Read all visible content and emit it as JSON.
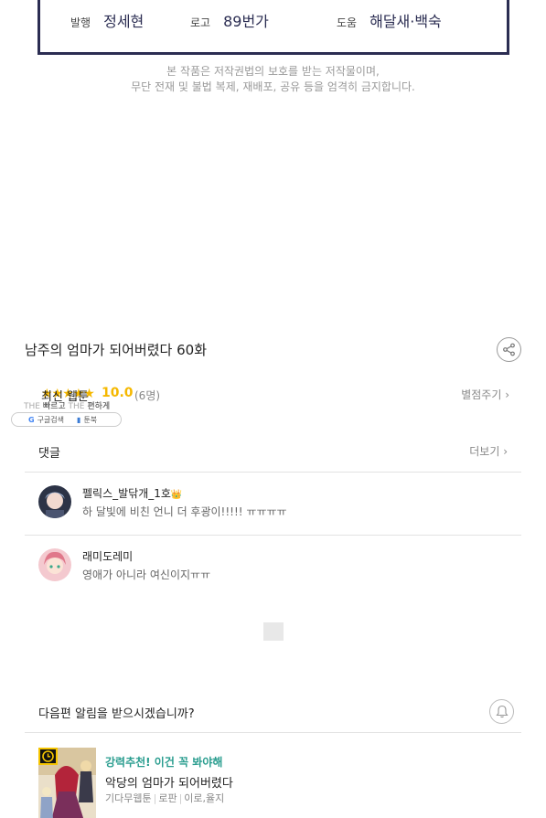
{
  "credits": [
    {
      "label": "발행",
      "value": "정세현"
    },
    {
      "label": "로고",
      "value": "89번가"
    },
    {
      "label": "도움",
      "value": "해달새·백숙"
    }
  ],
  "copyright": {
    "line1": "본 작품은 저작권법의 보호를 받는 저작물이며,",
    "line2": "무단 전재 및 불법 복제, 재배포, 공유 등을 엄격히 금지합니다."
  },
  "episode": {
    "title": "남주의 엄마가 되어버렸다 60화",
    "share_icon": "share-icon"
  },
  "rating": {
    "label": "최신 웹툰",
    "stars": "★★★★★",
    "score": "10.0",
    "count": "(6명)",
    "rate_link": "별점주기 ›"
  },
  "overlay_ad": {
    "line_a1": "THE",
    "line_a2": "빠르고",
    "line_b1": "THE",
    "line_b2": "편하게",
    "google_mark": "G",
    "google_text": "구글검색",
    "book_text": "툰북"
  },
  "comments_section": {
    "title": "댓글",
    "more": "더보기 ›",
    "items": [
      {
        "name": "펠릭스_발닦개_1호",
        "badge": "👑",
        "text": "하 달빛에 비친 언니 더 후광이!!!!! ㅠㅠㅠㅠ"
      },
      {
        "name": "래미도레미",
        "badge": "",
        "text": "영애가 아니라 여신이지ㅠㅠ"
      }
    ]
  },
  "notify": {
    "question": "다음편 알림을 받으시겠습니까?",
    "bell_icon": "bell-icon"
  },
  "recommend": {
    "tag": "강력추천! 이건 꼭 봐야해",
    "title": "악당의 엄마가 되어버렸다",
    "meta": [
      "기다무웹툰",
      "로판",
      "이로,율지"
    ]
  },
  "colors": {
    "credit_accent": "#2b2d52",
    "star": "#f5b800",
    "tag": "#2a9d8f"
  }
}
